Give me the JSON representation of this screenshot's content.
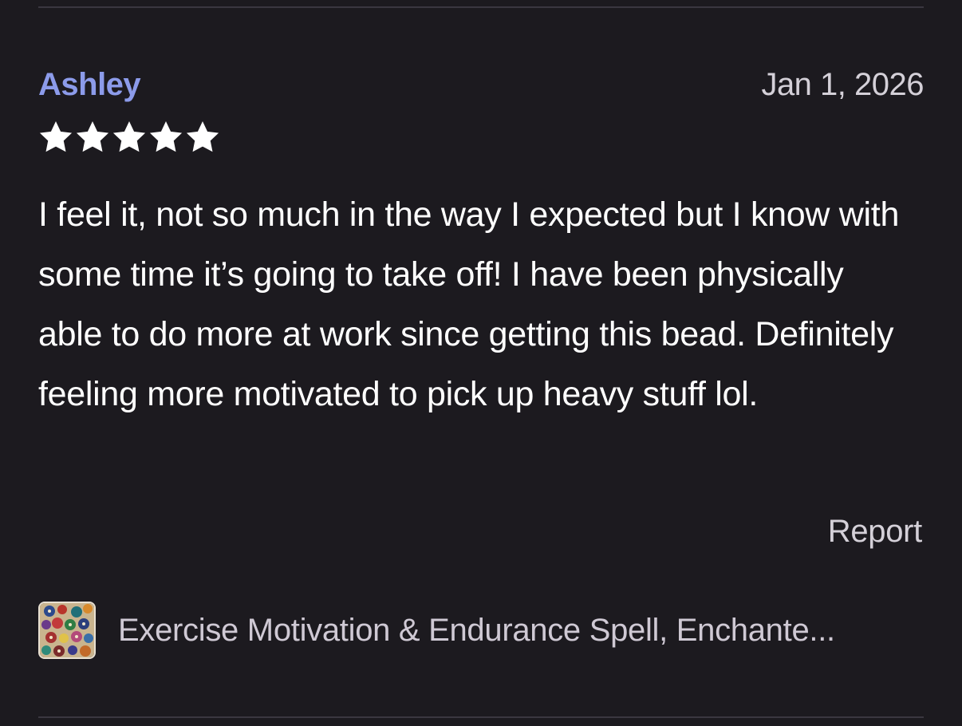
{
  "review": {
    "reviewer_name": "Ashley",
    "date": "Jan 1, 2026",
    "rating": 5,
    "rating_max": 5,
    "body": "I feel it, not so much in the way I expected but I know with some time it’s going to take off! I have been physically able to do more at work since getting this bead. Definitely feeling more motivated to pick up heavy stuff lol.",
    "report_label": "Report"
  },
  "product": {
    "title": "Exercise Motivation & Endurance Spell, Enchante...",
    "thumbnail_icon": "beads-photo"
  },
  "colors": {
    "background": "#1c1a1f",
    "reviewer_name": "#8c9bea",
    "star": "#ffffff",
    "muted_text": "#d4d0d8"
  }
}
